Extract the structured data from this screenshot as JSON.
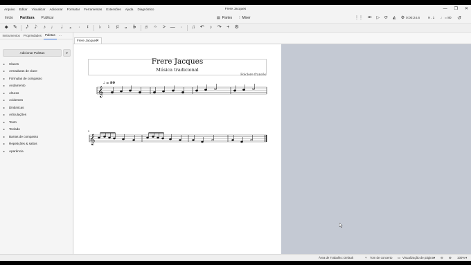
{
  "window": {
    "title": "Frere Jacques",
    "controls": {
      "minimize": "—",
      "maximize": "❐",
      "close": "✕"
    }
  },
  "menu": [
    "Arquivo",
    "Editar",
    "Visualizar",
    "Adicionar",
    "Formatar",
    "Ferramentas",
    "Extensões",
    "Ajuda",
    "Diagnóstico"
  ],
  "workspace_tabs": [
    {
      "label": "Início",
      "active": false
    },
    {
      "label": "Partitura",
      "active": true
    },
    {
      "label": "Publicar",
      "active": false
    }
  ],
  "center_tools": {
    "parts": "Partes",
    "mixer": "Mixer"
  },
  "playback": {
    "time": "0:00:24.6",
    "measure": "9 . 1",
    "tempo": "♩ = 80"
  },
  "note_toolbar": [
    "⬥",
    "✎",
    "𝅘𝅥𝅯",
    "𝅘𝅥𝅮",
    "♪",
    "♩",
    "𝅗𝅥",
    "𝅝",
    "·",
    "𝄽",
    "♭",
    "♮",
    "♯",
    "𝄪",
    "𝄫",
    "♬",
    "𝄐",
    ">",
    "—",
    "·",
    "♫",
    "↶",
    "♪",
    "↷",
    "+",
    "⚙"
  ],
  "left_panel": {
    "tabs": [
      {
        "label": "Instrumentos",
        "active": false
      },
      {
        "label": "Propriedades",
        "active": false
      },
      {
        "label": "Paletas",
        "active": true
      },
      {
        "label": "···",
        "active": false
      }
    ],
    "add_palette_label": "Adicionar Paletas",
    "palettes": [
      "Claves",
      "Armaduras de clave",
      "Fórmulas de compasso",
      "Andamento",
      "Alturas",
      "Acidentes",
      "Dinâmicas",
      "Articulações",
      "Texto",
      "Teclado",
      "Barras de compasso",
      "Repetições & saltos",
      "Aparência"
    ]
  },
  "document_tab": {
    "label": "Frere Jacques",
    "close": "✕"
  },
  "score": {
    "title": "Frere Jacques",
    "subtitle": "Música tradicional",
    "composer": "Folclore francês",
    "tempo_marking": "♩ = 80",
    "system_2_number": "5"
  },
  "status_bar": {
    "workspace": "Área de Trabalho: Default",
    "concert_pitch": "Tom de concerto",
    "view_mode": "Visualização de página",
    "zoom": "100%"
  },
  "colors": {
    "accent": "#2a6bd8",
    "score_bg": "#ffffff",
    "canvas_bg": "#c4c9d3"
  }
}
